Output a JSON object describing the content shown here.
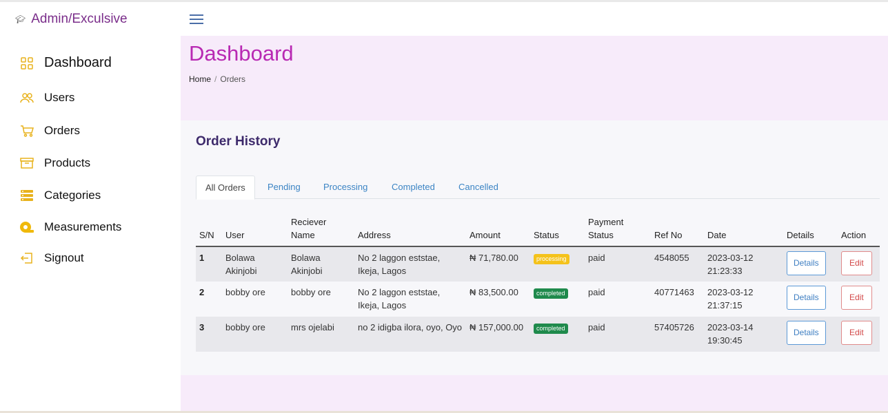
{
  "brand": {
    "title": "Admin/Exculsive",
    "icon": "graduation-cap-icon"
  },
  "sidebar": {
    "items": [
      {
        "label": "Dashboard",
        "icon": "dashboard-grid-icon"
      },
      {
        "label": "Users",
        "icon": "users-icon"
      },
      {
        "label": "Orders",
        "icon": "cart-icon"
      },
      {
        "label": "Products",
        "icon": "archive-box-icon"
      },
      {
        "label": "Categories",
        "icon": "categories-list-icon"
      },
      {
        "label": "Measurements",
        "icon": "measurement-icon"
      },
      {
        "label": "Signout",
        "icon": "signout-icon"
      }
    ]
  },
  "header": {
    "title": "Dashboard",
    "breadcrumb": {
      "home": "Home",
      "separator": "/",
      "current": "Orders"
    }
  },
  "order_history": {
    "title": "Order History",
    "tabs": [
      "All Orders",
      "Pending",
      "Processing",
      "Completed",
      "Cancelled"
    ],
    "active_tab": "All Orders",
    "columns": {
      "sn": "S/N",
      "user": "User",
      "receiver": "Reciever Name",
      "address": "Address",
      "amount": "Amount",
      "status": "Status",
      "payment_status": "Payment Status",
      "ref_no": "Ref No",
      "date": "Date",
      "details": "Details",
      "action": "Action"
    },
    "rows": [
      {
        "sn": "1",
        "user": "Bolawa Akinjobi",
        "receiver": "Bolawa Akinjobi",
        "address": "No 2 laggon eststae, Ikeja, Lagos",
        "amount": "₦ 71,780.00",
        "status": "processing",
        "payment_status": "paid",
        "ref_no": "4548055",
        "date": "2023-03-12 21:23:33",
        "details_label": "Details",
        "action_label": "Edit"
      },
      {
        "sn": "2",
        "user": "bobby ore",
        "receiver": "bobby ore",
        "address": "No 2 laggon eststae, Ikeja, Lagos",
        "amount": "₦ 83,500.00",
        "status": "completed",
        "payment_status": "paid",
        "ref_no": "40771463",
        "date": "2023-03-12 21:37:15",
        "details_label": "Details",
        "action_label": "Edit"
      },
      {
        "sn": "3",
        "user": "bobby ore",
        "receiver": "mrs ojelabi",
        "address": "no 2 idigba ilora, oyo, Oyo",
        "amount": "₦ 157,000.00",
        "status": "completed",
        "payment_status": "paid",
        "ref_no": "57405726",
        "date": "2023-03-14 19:30:45",
        "details_label": "Details",
        "action_label": "Edit"
      }
    ]
  },
  "colors": {
    "brand": "#7a2d8a",
    "page_title": "#b829b3",
    "main_bg": "#f7ebfa",
    "sidebar_icon": "#e8b21c",
    "link": "#3b84c4",
    "processing": "#f4c21b",
    "completed": "#1f8a4c"
  }
}
